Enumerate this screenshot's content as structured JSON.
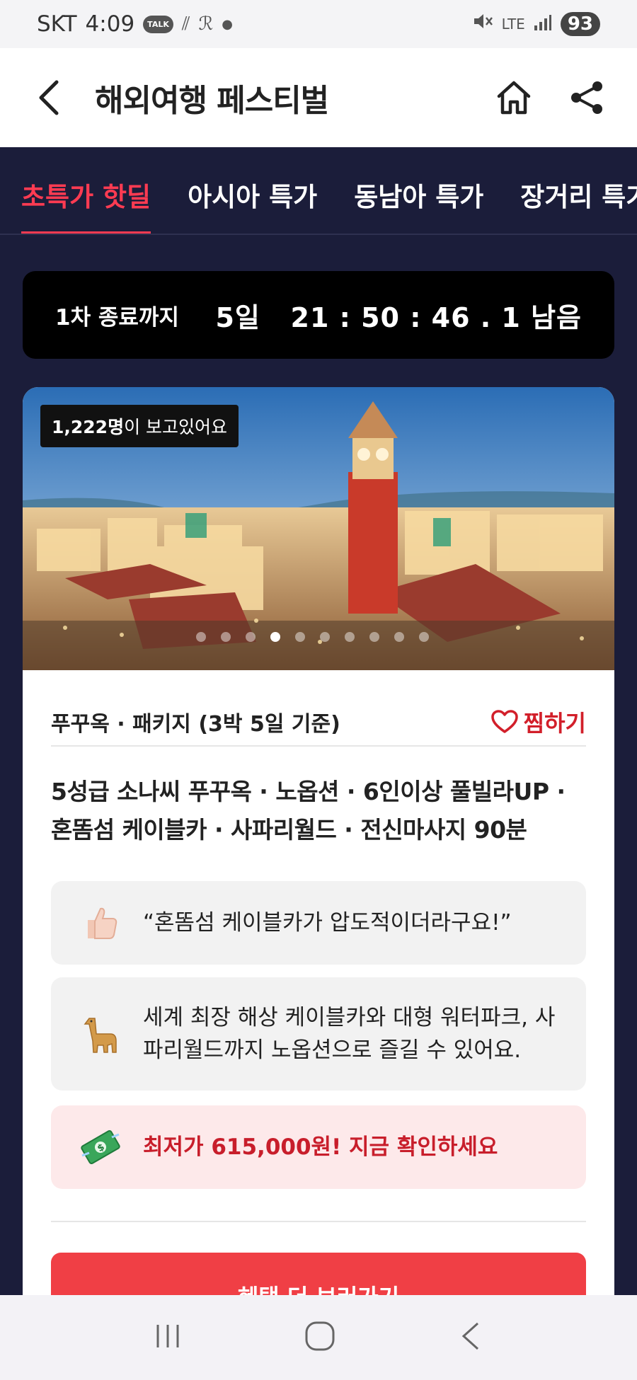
{
  "status_bar": {
    "carrier": "SKT",
    "time": "4:09",
    "talk_badge": "TALK",
    "battery": "93",
    "network": "LTE"
  },
  "header": {
    "title": "해외여행 페스티벌",
    "icons": [
      "back-icon",
      "home-icon",
      "share-icon"
    ]
  },
  "tabs": [
    {
      "label": "초특가 핫딜",
      "active": true
    },
    {
      "label": "아시아 특가",
      "active": false
    },
    {
      "label": "동남아 특가",
      "active": false
    },
    {
      "label": "장거리 특가",
      "active": false
    }
  ],
  "countdown": {
    "label": "1차 종료까지",
    "value": "5일   21 : 50 : 46 . 1 남음"
  },
  "product": {
    "viewers_count": "1,222명",
    "viewers_suffix": "이 보고있어요",
    "carousel": {
      "total": 10,
      "active_index": 3
    },
    "category": "푸꾸옥 · 패키지 (3박 5일 기준)",
    "wish_label": "찜하기",
    "title": "5성급 소나씨 푸꾸옥 · 노옵션 · 6인이상 풀빌라UP · 혼똠섬 케이블카 · 사파리월드 · 전신마사지 90분",
    "review_quote": "“혼똠섬 케이블카가 압도적이더라구요!”",
    "feature_text": "세계 최장 해상 케이블카와 대형 워터파크, 사파리월드까지 노옵션으로 즐길 수 있어요.",
    "promo_text": "최저가 615,000원! 지금 확인하세요",
    "cta_label": "혜택 더 보러가기"
  },
  "colors": {
    "accent": "#ff3b52",
    "background": "#1b1d3a",
    "cta": "#f03f45",
    "promo_bg": "#fde9ea"
  }
}
